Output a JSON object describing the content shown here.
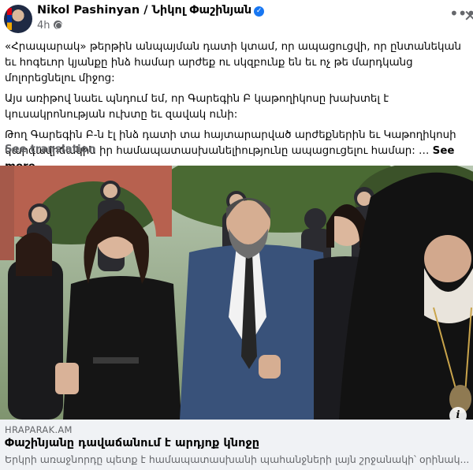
{
  "post": {
    "author": "Nikol Pashinyan / Նիկոլ Փաշինյան",
    "time": "4h",
    "more_icon": "ellipsis-icon",
    "close_icon": "close-icon",
    "paragraphs": [
      "«Հրապարակ» թերթին անպայման դատի կտամ, որ ապացուցվի, որ ընտանեկան եւ հոգեւոր կյանքը ինձ համար արժեք ու սկզբունք են եւ ոչ թե մարդկանց մոլորեցնելու միջոց:",
      "Այս առիթով նաեւ պնդում եմ, որ Գարեգին Բ կաթողիկոսը խախտել է կուսակրոնության ուխտը եւ զավակ ունի:",
      "Թող Գարեգին Բ-ն էլ ինձ դատի տա հայտարարված արժեքներին եւ Կաթողիկոսի կարգավիճակին իր համապատասխանելիությունը ապացուցելու համար: …"
    ],
    "see_more": "See more",
    "see_translation": "See translation"
  },
  "link_preview": {
    "domain": "HRAPARAK.AM",
    "title": "Փաշինյանը դավաճանում է արդյոք կնոջը",
    "description": "Երկրի առաջնորդը պետք է համապատասխանի պահանջների լայն շրջանակի՝ օրինակ..."
  },
  "colors": {
    "accent": "#1877f2",
    "secondary_text": "#65676b",
    "card_bg": "#f0f2f5"
  }
}
